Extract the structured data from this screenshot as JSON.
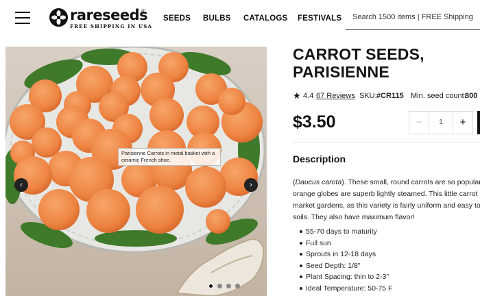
{
  "header": {
    "logo_text": "rareseeds",
    "logo_tagline": "FREE SHIPPING IN USA",
    "logo_reg": "®",
    "nav": [
      {
        "label": "SEEDS"
      },
      {
        "label": "BULBS"
      },
      {
        "label": "CATALOGS"
      },
      {
        "label": "FESTIVALS"
      }
    ],
    "search_placeholder": "Search 1500 items | FREE Shipping"
  },
  "gallery": {
    "caption": "Parisienne Carrots in metal basket with a ceramic French shoe.",
    "prev_icon": "‹",
    "next_icon": "›",
    "slides": 4,
    "active_slide": 1
  },
  "product": {
    "title": "CARROT SEEDS, PARISIENNE",
    "star_icon": "★",
    "rating": "4.4",
    "reviews": "67 Reviews",
    "sku_label": "SKU:",
    "sku": "#CR115",
    "min_label": "Min. seed count:",
    "min_count": "800",
    "price": "$3.50",
    "quantity": {
      "minus": "−",
      "value": "1",
      "plus": "+"
    }
  },
  "description": {
    "heading": "Description",
    "latin": "Daucus carota",
    "lines": [
      "). These small, round carrots are so popular i",
      "orange globes are superb lightly steamed. This little carrot is",
      "market gardens, as this variety is fairly uniform and easy to g",
      "soils. They also have maximum flavor!"
    ],
    "bullets": [
      "55-70 days to maturity",
      "Full sun",
      "Sprouts in 12-18 days",
      "Seed Depth: 1/8\"",
      "Plant Spacing: thin to 2-3\"",
      "Ideal Temperature: 50-75 F"
    ]
  },
  "colors": {
    "carrot": "#f0894a",
    "carrot_shadow": "#d9692c",
    "leaf": "#3f7a2a",
    "basket": "#c9c9c9",
    "text": "#1a1a1a"
  }
}
